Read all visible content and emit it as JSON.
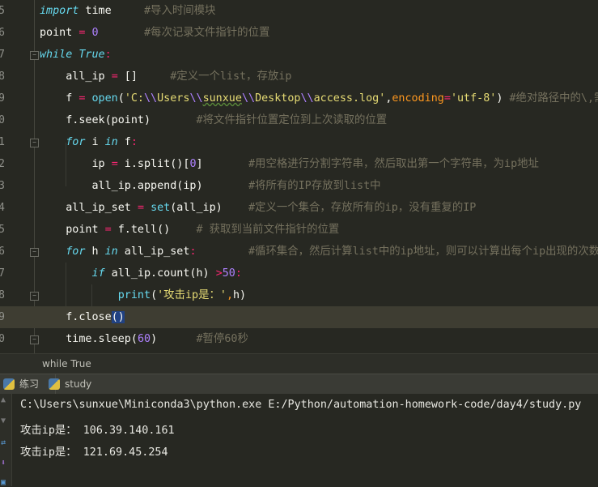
{
  "editor": {
    "lines": [
      {
        "num": "5",
        "tokens": [
          [
            "k",
            "import"
          ],
          [
            "t",
            " time     "
          ],
          [
            "c",
            "#导入时间模块"
          ]
        ]
      },
      {
        "num": "6",
        "tokens": [
          [
            "t",
            "point "
          ],
          [
            "o",
            "="
          ],
          [
            "t",
            " "
          ],
          [
            "n",
            "0"
          ],
          [
            "t",
            "       "
          ],
          [
            "c",
            "#每次记录文件指针的位置"
          ]
        ]
      },
      {
        "num": "7",
        "tokens": [
          [
            "k",
            "while"
          ],
          [
            "t",
            " "
          ],
          [
            "k",
            "True"
          ],
          [
            "o",
            ":"
          ]
        ]
      },
      {
        "num": "8",
        "tokens": [
          [
            "t",
            "    all_ip "
          ],
          [
            "o",
            "="
          ],
          [
            "t",
            " []     "
          ],
          [
            "c",
            "#定义一个list，存放ip"
          ]
        ]
      },
      {
        "num": "9",
        "tokens": [
          [
            "t",
            "    f "
          ],
          [
            "o",
            "="
          ],
          [
            "t",
            " "
          ],
          [
            "b",
            "open"
          ],
          [
            "t",
            "("
          ],
          [
            "s",
            "'C:"
          ],
          [
            "n",
            "\\\\"
          ],
          [
            "s",
            "Users"
          ],
          [
            "n",
            "\\\\"
          ],
          [
            "w",
            "sunxue"
          ],
          [
            "n",
            "\\\\"
          ],
          [
            "s",
            "Desktop"
          ],
          [
            "n",
            "\\\\"
          ],
          [
            "s",
            "access.log'"
          ],
          [
            "t",
            ","
          ],
          [
            "p",
            "encoding"
          ],
          [
            "o",
            "="
          ],
          [
            "s",
            "'utf-8'"
          ],
          [
            "t",
            ") "
          ],
          [
            "c",
            "#绝对路径中的\\,需"
          ]
        ]
      },
      {
        "num": "0",
        "tokens": [
          [
            "t",
            "    f.seek(point)       "
          ],
          [
            "c",
            "#将文件指针位置定位到上次读取的位置"
          ]
        ]
      },
      {
        "num": "1",
        "tokens": [
          [
            "t",
            "    "
          ],
          [
            "k",
            "for"
          ],
          [
            "t",
            " i "
          ],
          [
            "k",
            "in"
          ],
          [
            "t",
            " f"
          ],
          [
            "o",
            ":"
          ]
        ]
      },
      {
        "num": "2",
        "tokens": [
          [
            "t",
            "        ip "
          ],
          [
            "o",
            "="
          ],
          [
            "t",
            " i.split()["
          ],
          [
            "n",
            "0"
          ],
          [
            "t",
            "]       "
          ],
          [
            "c",
            "#用空格进行分割字符串，然后取出第一个字符串，为ip地址"
          ]
        ]
      },
      {
        "num": "3",
        "tokens": [
          [
            "t",
            "        all_ip.append(ip)       "
          ],
          [
            "c",
            "#将所有的IP存放到list中"
          ]
        ]
      },
      {
        "num": "4",
        "tokens": [
          [
            "t",
            "    all_ip_set "
          ],
          [
            "o",
            "="
          ],
          [
            "t",
            " "
          ],
          [
            "b",
            "set"
          ],
          [
            "t",
            "(all_ip)    "
          ],
          [
            "c",
            "#定义一个集合，存放所有的ip，没有重复的IP"
          ]
        ]
      },
      {
        "num": "5",
        "tokens": [
          [
            "t",
            "    point "
          ],
          [
            "o",
            "="
          ],
          [
            "t",
            " f.tell()    "
          ],
          [
            "c",
            "# 获取到当前文件指针的位置"
          ]
        ]
      },
      {
        "num": "6",
        "tokens": [
          [
            "t",
            "    "
          ],
          [
            "k",
            "for"
          ],
          [
            "t",
            " h "
          ],
          [
            "k",
            "in"
          ],
          [
            "t",
            " all_ip_set"
          ],
          [
            "o",
            ":"
          ],
          [
            "t",
            "        "
          ],
          [
            "c",
            "#循环集合，然后计算list中的ip地址，则可以计算出每个ip出现的次数"
          ]
        ]
      },
      {
        "num": "7",
        "tokens": [
          [
            "t",
            "        "
          ],
          [
            "k",
            "if"
          ],
          [
            "t",
            " all_ip.count(h) "
          ],
          [
            "o",
            ">"
          ],
          [
            "n",
            "50"
          ],
          [
            "o",
            ":"
          ]
        ]
      },
      {
        "num": "8",
        "tokens": [
          [
            "t",
            "            "
          ],
          [
            "b",
            "print"
          ],
          [
            "t",
            "("
          ],
          [
            "s",
            "'攻击ip是：'"
          ],
          [
            "p",
            ","
          ],
          [
            "t",
            "h)"
          ]
        ]
      },
      {
        "num": "9",
        "tokens": [
          [
            "t",
            "    f.close"
          ],
          [
            "h",
            "()"
          ]
        ]
      },
      {
        "num": "0",
        "tokens": [
          [
            "t",
            "    time.sleep("
          ],
          [
            "n",
            "60"
          ],
          [
            "t",
            ")      "
          ],
          [
            "c",
            "#暂停60秒"
          ]
        ]
      }
    ]
  },
  "breadcrumb": "while True",
  "tabs": [
    {
      "label": "练习"
    },
    {
      "label": "study"
    }
  ],
  "console": {
    "command": "C:\\Users\\sunxue\\Miniconda3\\python.exe E:/Python/automation-homework-code/day4/study.py",
    "output": [
      "攻击ip是： 106.39.140.161",
      "攻击ip是： 121.69.45.254"
    ]
  },
  "colors": {
    "background": "#272822",
    "keyword": "#66d9ef",
    "operator": "#f92672",
    "number": "#ae81ff",
    "string": "#e6db74",
    "comment": "#75715e"
  }
}
